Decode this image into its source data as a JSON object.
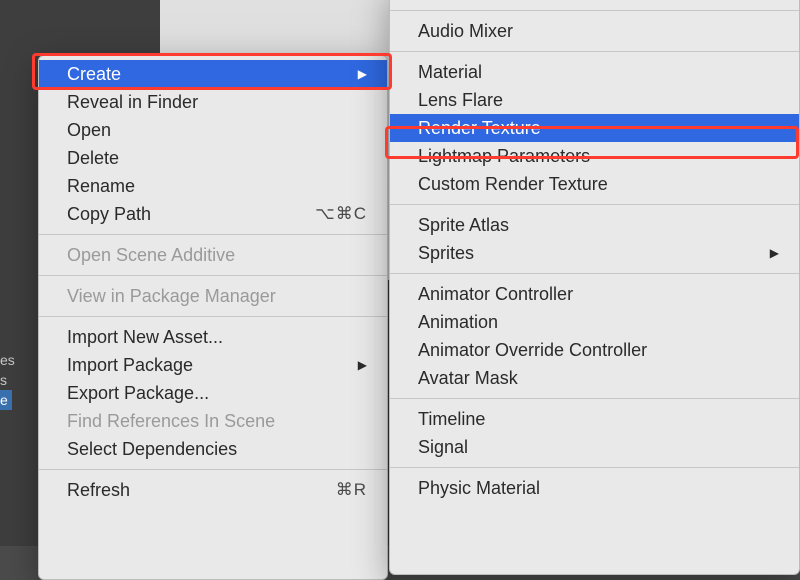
{
  "primary_menu": {
    "create": "Create",
    "reveal": "Reveal in Finder",
    "open": "Open",
    "delete": "Delete",
    "rename": "Rename",
    "copy_path": "Copy Path",
    "copy_path_shortcut": "⌥⌘C",
    "open_scene_additive": "Open Scene Additive",
    "view_package_manager": "View in Package Manager",
    "import_new_asset": "Import New Asset...",
    "import_package": "Import Package",
    "export_package": "Export Package...",
    "find_references": "Find References In Scene",
    "select_dependencies": "Select Dependencies",
    "refresh": "Refresh",
    "refresh_shortcut": "⌘R"
  },
  "secondary_menu": {
    "audio_mixer": "Audio Mixer",
    "material": "Material",
    "lens_flare": "Lens Flare",
    "render_texture": "Render Texture",
    "lightmap_parameters": "Lightmap Parameters",
    "custom_render_texture": "Custom Render Texture",
    "sprite_atlas": "Sprite Atlas",
    "sprites": "Sprites",
    "animator_controller": "Animator Controller",
    "animation": "Animation",
    "animator_override_controller": "Animator Override Controller",
    "avatar_mask": "Avatar Mask",
    "timeline": "Timeline",
    "signal": "Signal",
    "physic_material": "Physic Material"
  },
  "hierarchy": {
    "line1": "es",
    "line2": "s",
    "line3": "e"
  }
}
